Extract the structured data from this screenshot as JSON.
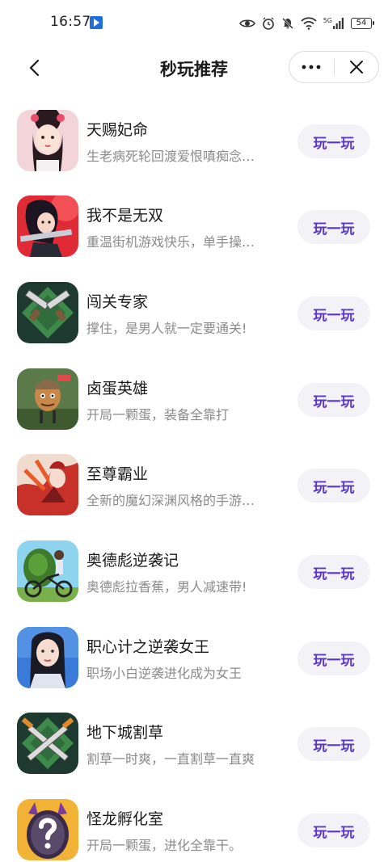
{
  "status_bar": {
    "time": "16:57",
    "network": "5G",
    "battery": "54"
  },
  "nav": {
    "title": "秒玩推荐"
  },
  "games": [
    {
      "name": "天赐妃命",
      "desc": "生老病死轮回渡爱恨嗔痴念…",
      "action": "玩一玩",
      "icon": "palace-lady-icon"
    },
    {
      "name": "我不是无双",
      "desc": "重温街机游戏快乐，单手操…",
      "action": "玩一玩",
      "icon": "warrior-girl-icon"
    },
    {
      "name": "闯关专家",
      "desc": "撑住，是男人就一定要通关!",
      "action": "玩一玩",
      "icon": "crossed-guns-icon"
    },
    {
      "name": "卤蛋英雄",
      "desc": "开局一颗蛋，装备全靠打",
      "action": "玩一玩",
      "icon": "egg-hero-icon"
    },
    {
      "name": "至尊霸业",
      "desc": "全新的魔幻深渊风格的手游…",
      "action": "玩一玩",
      "icon": "demon-warrior-icon"
    },
    {
      "name": "奥德彪逆袭记",
      "desc": "奥德彪拉香蕉，男人减速带!",
      "action": "玩一玩",
      "icon": "banana-bike-icon"
    },
    {
      "name": "职心计之逆袭女王",
      "desc": "职场小白逆袭进化成为女王",
      "action": "玩一玩",
      "icon": "office-woman-icon"
    },
    {
      "name": "地下城割草",
      "desc": "割草一时爽，一直割草一直爽",
      "action": "玩一玩",
      "icon": "crossed-swords-icon"
    },
    {
      "name": "怪龙孵化室",
      "desc": "开局一颗蛋，进化全靠干。",
      "action": "玩一玩",
      "icon": "mystery-egg-icon"
    }
  ],
  "colors": {
    "accent": "#5b35c9",
    "button_bg": "#f2f2f7",
    "desc_text": "#8a8a8a"
  }
}
